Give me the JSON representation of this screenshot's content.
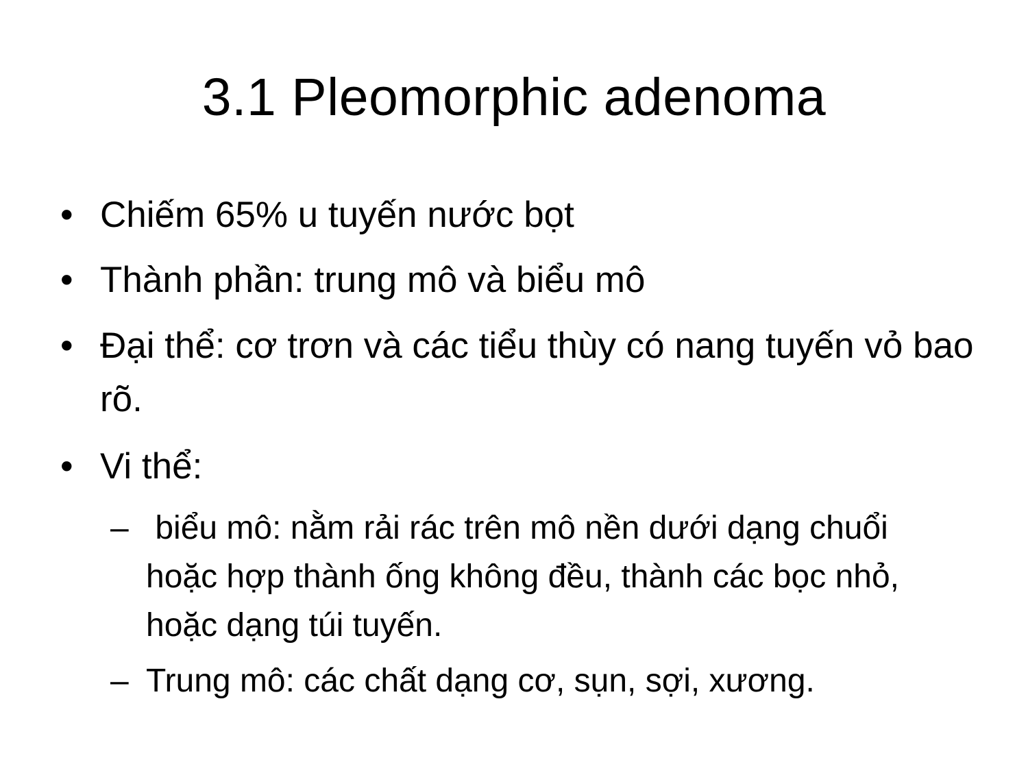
{
  "slide": {
    "title": "3.1 Pleomorphic adenoma",
    "bullet_marker": "•",
    "sub_marker": "–",
    "bullets": [
      "Chiếm 65% u tuyến nước bọt",
      "Thành phần: trung mô và biểu mô",
      "Đại thể: cơ trơn và các tiểu thùy có nang tuyến vỏ bao rõ.",
      "Vi thể:"
    ],
    "sub_bullets": [
      " biểu mô: nằm rải rác trên mô nền dưới dạng chuổi hoặc hợp thành ống không đều, thành các bọc nhỏ, hoặc dạng túi tuyến.",
      "Trung mô: các chất dạng cơ, sụn, sợi, xương."
    ]
  }
}
